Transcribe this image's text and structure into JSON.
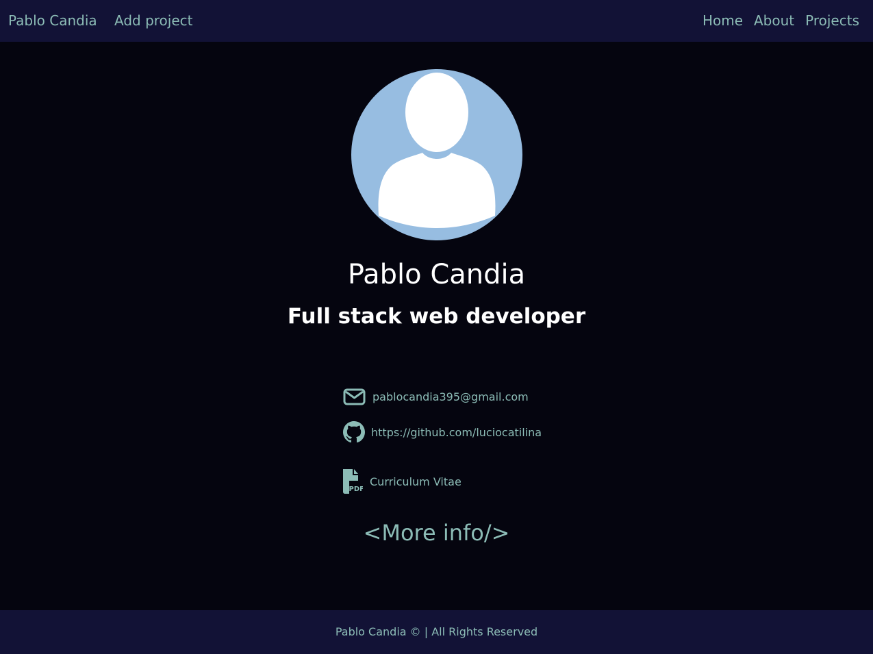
{
  "navbar": {
    "brand": "Pablo Candia",
    "add_project": "Add project",
    "links": [
      "Home",
      "About",
      "Projects"
    ]
  },
  "profile": {
    "avatar_icon": "default-user-avatar",
    "name": "Pablo Candia",
    "role": "Full stack web developer"
  },
  "contacts": {
    "email": {
      "icon": "envelope-icon",
      "text": "pablocandia395@gmail.com"
    },
    "github": {
      "icon": "github-icon",
      "text": "https://github.com/luciocatilina"
    },
    "cv": {
      "icon": "file-pdf-icon",
      "text": "Curriculum Vitae"
    }
  },
  "more_info": "<More info/>",
  "footer": {
    "text": "Pablo Candia © | All Rights Reserved"
  },
  "colors": {
    "background": "#05050f",
    "navbar": "#121236",
    "accent": "#8cbcb6",
    "avatar_bg": "#97bde1",
    "text": "#ffffff"
  }
}
